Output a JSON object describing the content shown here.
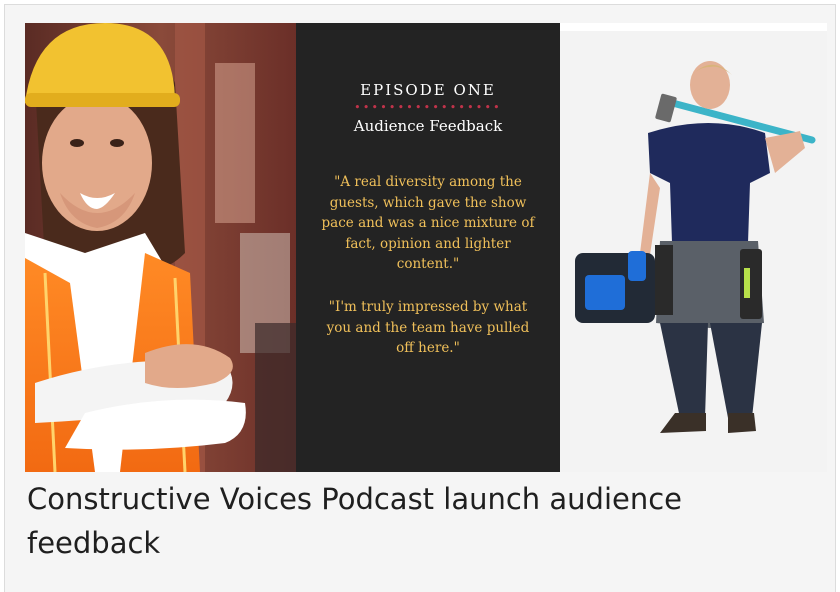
{
  "banner": {
    "episode_title": "EPISODE ONE",
    "dots": "•••••••••••••••••",
    "subtitle": "Audience Feedback",
    "quote1": "\"A real diversity among the guests, which gave the show pace and was a nice mixture of fact, opinion and lighter content.\"",
    "quote2": "\"I'm truly impressed by what you and the team have pulled off here.\""
  },
  "caption": "Constructive Voices Podcast launch audience feedback",
  "colors": {
    "panel_bg": "#232323",
    "quote_text": "#f0c05a",
    "dot_accent": "#c0334a",
    "hard_hat": "#f2c230",
    "safety_vest": "#ff7e1f",
    "tshirt": "#1f2a5c"
  }
}
